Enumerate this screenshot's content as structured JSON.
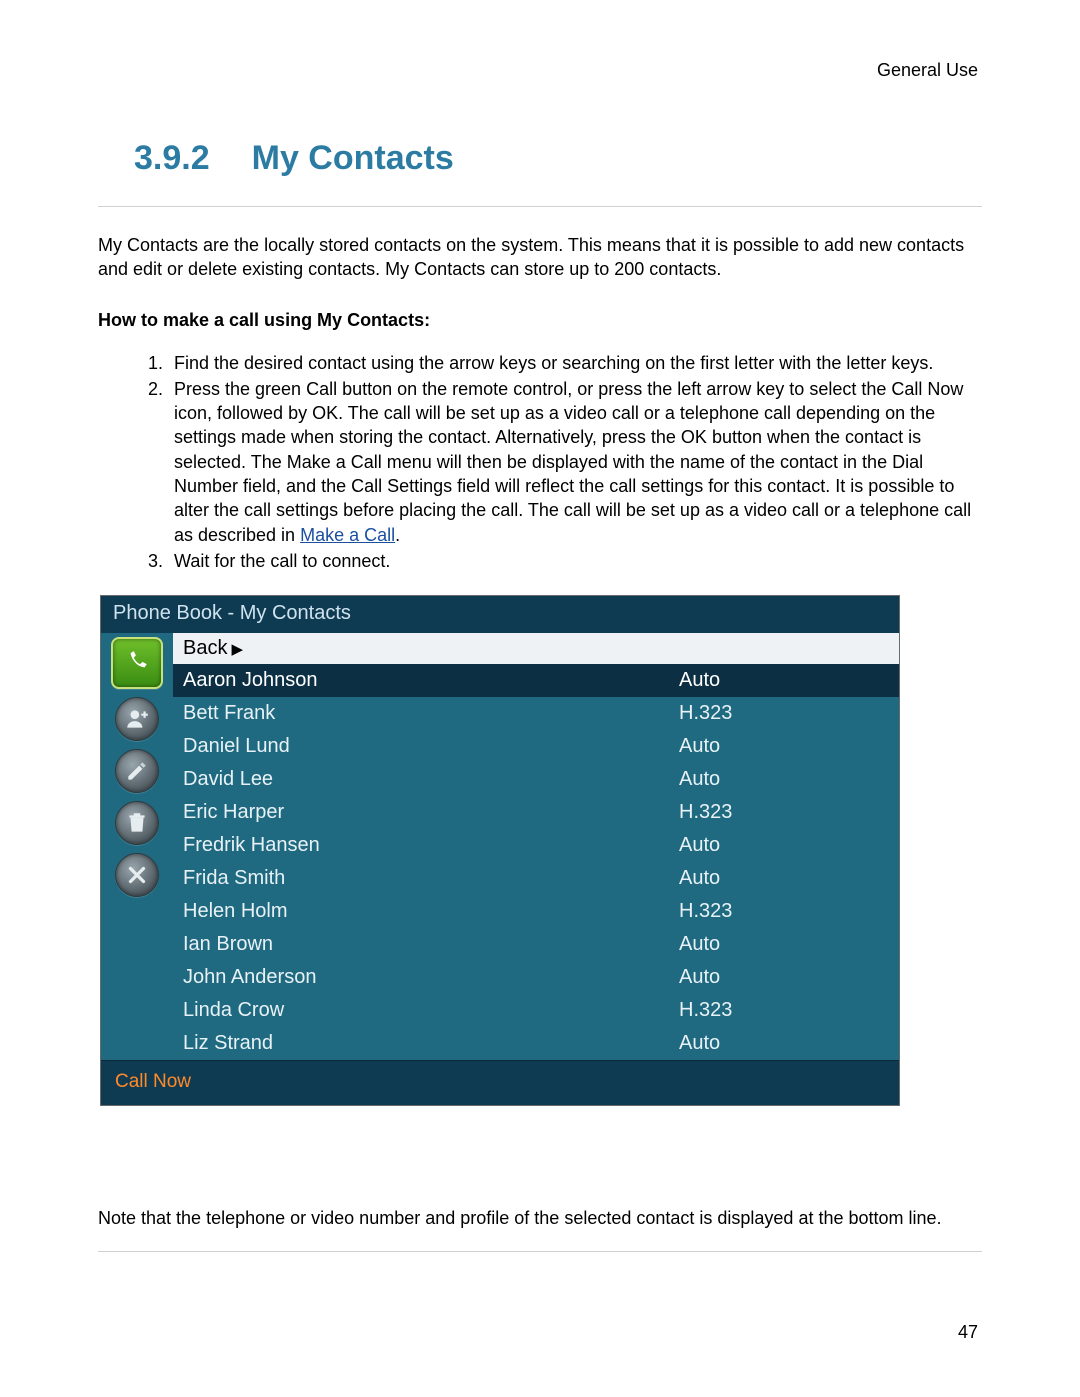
{
  "header": {
    "category": "General Use"
  },
  "section": {
    "number": "3.9.2",
    "title": "My Contacts"
  },
  "intro": "My Contacts are the locally stored contacts on the system. This means that it is possible to add new contacts and edit or delete existing contacts. My Contacts can store up to 200 contacts.",
  "howto_heading": "How to make a call using My Contacts:",
  "steps": {
    "s1": "Find the desired contact using the arrow keys or searching on the first letter with the letter keys.",
    "s2a": "Press the green Call button on the remote control, or press the left arrow key to select the Call Now icon, followed by OK. The call will be set up as a video call or a telephone call depending on the settings made when storing the contact. Alternatively, press the OK button when the contact is selected. The Make a Call menu will then be displayed with the name of the contact in the Dial Number field, and the Call Settings field will reflect the call settings for this contact. It is possible to alter the call settings before placing the call. The call will be set up as a video call or a telephone call as described in ",
    "s2_link": "Make a Call",
    "s2b": ".",
    "s3": "Wait for the call to connect."
  },
  "phonebook": {
    "title": "Phone Book - My Contacts",
    "back_label": "Back",
    "footer_label": "Call Now",
    "side_icons": [
      "call-icon",
      "new-contact-icon",
      "edit-icon",
      "delete-icon",
      "close-icon"
    ],
    "contacts": [
      {
        "name": "Aaron Johnson",
        "proto": "Auto",
        "selected": true
      },
      {
        "name": "Bett Frank",
        "proto": "H.323"
      },
      {
        "name": "Daniel Lund",
        "proto": "Auto"
      },
      {
        "name": "David Lee",
        "proto": "Auto"
      },
      {
        "name": "Eric Harper",
        "proto": "H.323"
      },
      {
        "name": "Fredrik Hansen",
        "proto": "Auto"
      },
      {
        "name": "Frida Smith",
        "proto": "Auto"
      },
      {
        "name": "Helen Holm",
        "proto": "H.323"
      },
      {
        "name": "Ian Brown",
        "proto": "Auto"
      },
      {
        "name": "John Anderson",
        "proto": "Auto"
      },
      {
        "name": "Linda Crow",
        "proto": "H.323"
      },
      {
        "name": "Liz Strand",
        "proto": "Auto"
      }
    ]
  },
  "note": "Note that the telephone or video number and profile of the selected contact is displayed at the bottom line.",
  "page_number": "47"
}
